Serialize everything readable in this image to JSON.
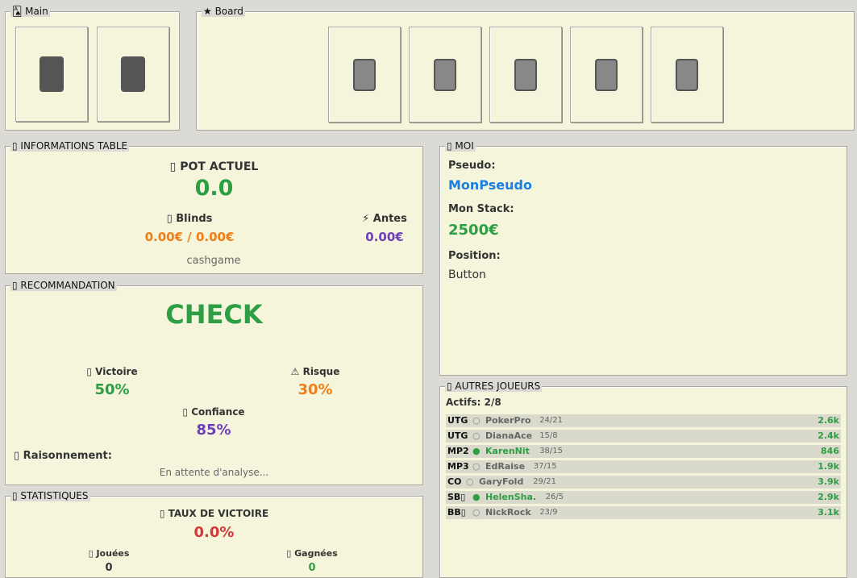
{
  "main": {
    "title": "🂡 Main"
  },
  "board": {
    "title": "★ Board"
  },
  "table_info": {
    "title": "▯ INFORMATIONS TABLE",
    "pot_label": "▯ POT ACTUEL",
    "pot_value": "0.0",
    "blinds_label": "▯ Blinds",
    "blinds_value": "0.00€ / 0.00€",
    "antes_label": "⚡ Antes",
    "antes_value": "0.00€",
    "game_type": "cashgame"
  },
  "recommendation": {
    "title": "▯ RECOMMANDATION",
    "action": "CHECK",
    "victory_label": "▯ Victoire",
    "victory_value": "50%",
    "risk_label": "⚠ Risque",
    "risk_value": "30%",
    "confidence_label": "▯ Confiance",
    "confidence_value": "85%",
    "reasoning_label": "▯ Raisonnement:",
    "reasoning_value": "En attente d'analyse..."
  },
  "stats": {
    "title": "▯ STATISTIQUES",
    "winrate_label": "▯ TAUX DE VICTOIRE",
    "winrate_value": "0.0%",
    "played_label": "▯ Jouées",
    "played_value": "0",
    "won_label": "▯ Gagnées",
    "won_value": "0"
  },
  "me": {
    "title": "▯ MOI",
    "pseudo_label": "Pseudo:",
    "pseudo_value": "MonPseudo",
    "stack_label": "Mon Stack:",
    "stack_value": "2500€",
    "position_label": "Position:",
    "position_value": "Button"
  },
  "others": {
    "title": "▯ AUTRES JOUEURS",
    "active_label": "Actifs:",
    "active_value": "2/8",
    "players": [
      {
        "pos": "UTG",
        "dot": "○",
        "name": "PokerPro",
        "stats": "24/21",
        "stack": "2.6k",
        "active": false
      },
      {
        "pos": "UTG",
        "dot": "○",
        "name": "DianaAce",
        "stats": "15/8",
        "stack": "2.4k",
        "active": false
      },
      {
        "pos": "MP2",
        "dot": "●",
        "name": "KarenNit",
        "stats": "38/15",
        "stack": "846",
        "active": true
      },
      {
        "pos": "MP3",
        "dot": "○",
        "name": "EdRaise",
        "stats": "37/15",
        "stack": "1.9k",
        "active": false
      },
      {
        "pos": "CO",
        "dot": "○",
        "name": "GaryFold",
        "stats": "29/21",
        "stack": "3.9k",
        "active": false
      },
      {
        "pos": "SB▯",
        "dot": "●",
        "name": "HelenSha.",
        "stats": "26/5",
        "stack": "2.9k",
        "active": true
      },
      {
        "pos": "BB▯",
        "dot": "○",
        "name": "NickRock",
        "stats": "23/9",
        "stack": "3.1k",
        "active": false
      }
    ]
  }
}
